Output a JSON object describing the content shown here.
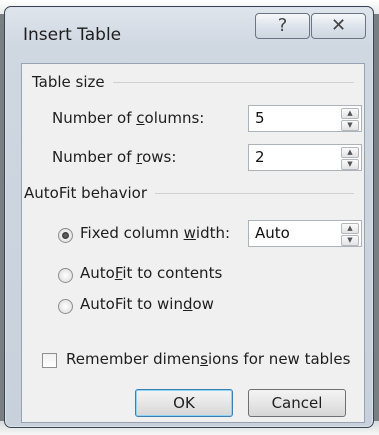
{
  "window": {
    "title": "Insert Table",
    "help_glyph": "?",
    "close_glyph": "✕"
  },
  "table_size": {
    "group_label": "Table size",
    "columns": {
      "label_pre": "Number of ",
      "label_key": "c",
      "label_post": "olumns:",
      "value": "5"
    },
    "rows": {
      "label_pre": "Number of ",
      "label_key": "r",
      "label_post": "ows:",
      "value": "2"
    }
  },
  "autofit": {
    "group_label": "AutoFit behavior",
    "selected": "fixed",
    "fixed": {
      "label_pre": "Fixed column ",
      "label_key": "w",
      "label_post": "idth:",
      "value": "Auto"
    },
    "contents": {
      "label_pre": "Auto",
      "label_key": "F",
      "label_post": "it to contents"
    },
    "window": {
      "label_pre": "AutoFit to win",
      "label_key": "d",
      "label_post": "ow"
    }
  },
  "remember": {
    "label_pre": "Remember dimen",
    "label_key": "s",
    "label_post": "ions for new tables",
    "checked": false
  },
  "buttons": {
    "ok": "OK",
    "cancel": "Cancel"
  }
}
